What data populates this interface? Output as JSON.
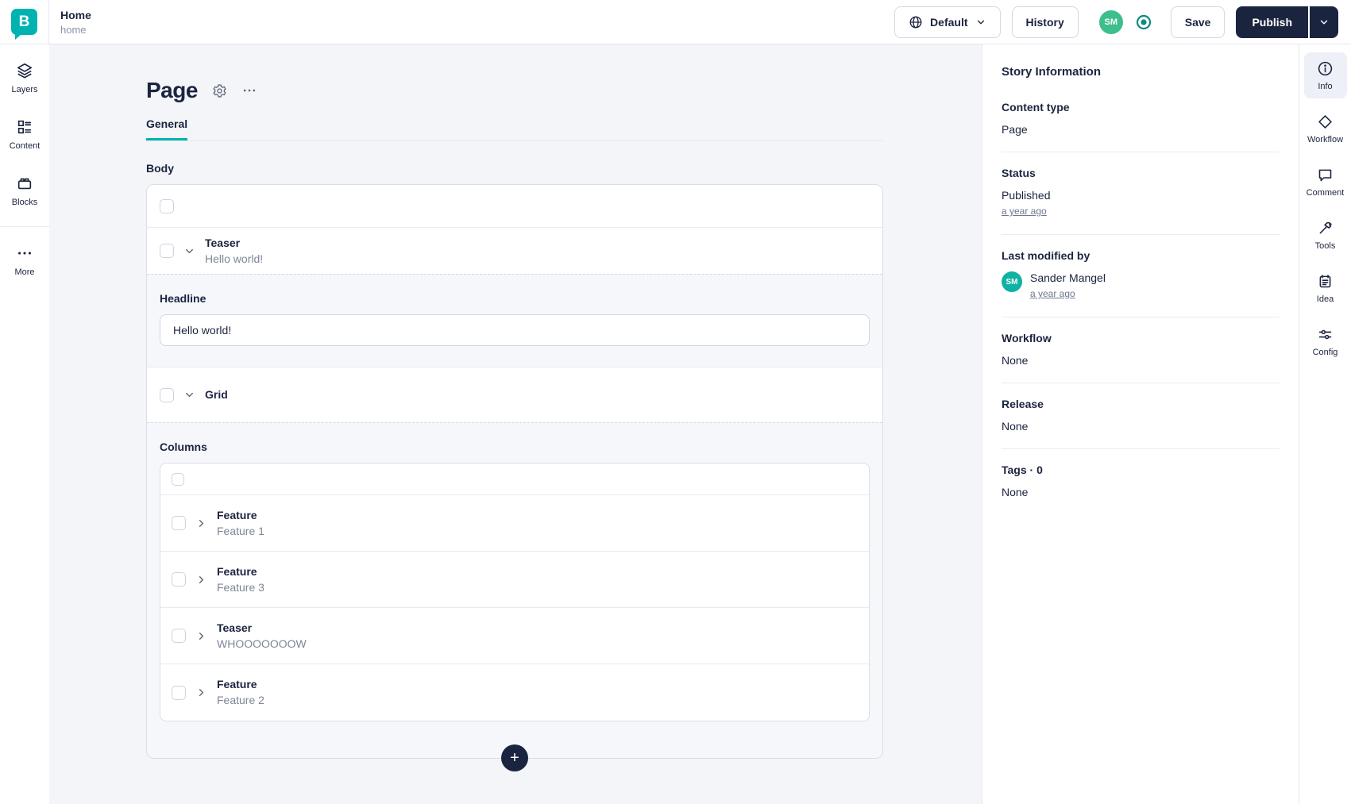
{
  "brand": {
    "logo_letter": "B",
    "colors": {
      "teal": "#00b3b0",
      "navy": "#1b243f",
      "avatar_green": "#3dbe8b",
      "panel_avatar_teal": "#10b2a3"
    }
  },
  "header": {
    "breadcrumb": {
      "title": "Home",
      "subtitle": "home"
    },
    "language_button": "Default",
    "history_button": "History",
    "avatar_initials": "SM",
    "save_button": "Save",
    "publish_button": "Publish"
  },
  "left_rail": {
    "items": [
      {
        "label": "Layers"
      },
      {
        "label": "Content"
      },
      {
        "label": "Blocks"
      },
      {
        "label": "More"
      }
    ]
  },
  "editor": {
    "title": "Page",
    "tab": "General",
    "body_label": "Body",
    "teaser": {
      "title": "Teaser",
      "subtitle": "Hello world!"
    },
    "headline_field": {
      "label": "Headline",
      "value": "Hello world!"
    },
    "grid": {
      "title": "Grid",
      "columns_label": "Columns",
      "children": [
        {
          "title": "Feature",
          "subtitle": "Feature 1"
        },
        {
          "title": "Feature",
          "subtitle": "Feature 3"
        },
        {
          "title": "Teaser",
          "subtitle": "WHOOOOOOOW"
        },
        {
          "title": "Feature",
          "subtitle": "Feature 2"
        }
      ]
    },
    "add_block_button": "+"
  },
  "story_info": {
    "title": "Story Information",
    "content_type": {
      "label": "Content type",
      "value": "Page"
    },
    "status": {
      "label": "Status",
      "value": "Published",
      "time": "a year ago"
    },
    "last_modified": {
      "label": "Last modified by",
      "user": "Sander Mangel",
      "initials": "SM",
      "time": "a year ago"
    },
    "workflow": {
      "label": "Workflow",
      "value": "None"
    },
    "release": {
      "label": "Release",
      "value": "None"
    },
    "tags": {
      "label": "Tags · 0",
      "value": "None"
    }
  },
  "right_rail": {
    "items": [
      {
        "label": "Info"
      },
      {
        "label": "Workflow"
      },
      {
        "label": "Comment"
      },
      {
        "label": "Tools"
      },
      {
        "label": "Idea"
      },
      {
        "label": "Config"
      }
    ]
  }
}
